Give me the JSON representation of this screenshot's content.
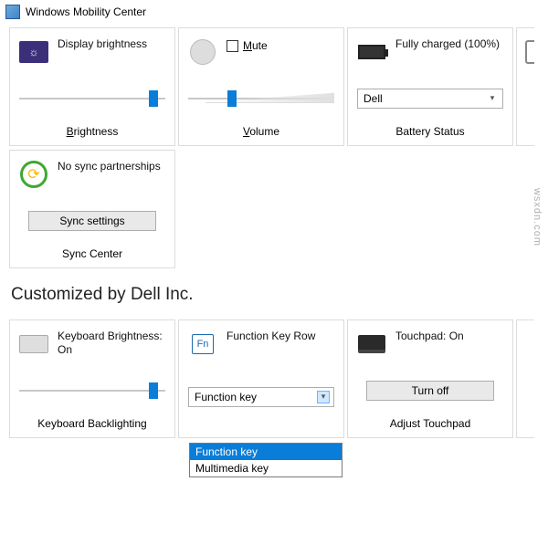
{
  "window": {
    "title": "Windows Mobility Center"
  },
  "tiles": {
    "brightness": {
      "desc": "Display brightness",
      "footer": "Brightness",
      "slider_pct": 92
    },
    "volume": {
      "mute_label": "Mute",
      "footer": "Volume",
      "slider_pct": 30
    },
    "battery": {
      "desc": "Fully charged (100%)",
      "select_value": "Dell",
      "footer": "Battery Status"
    },
    "sync": {
      "desc": "No sync partnerships",
      "button": "Sync settings",
      "footer": "Sync Center"
    }
  },
  "custom_header": "Customized by Dell Inc.",
  "custom_tiles": {
    "keyboard": {
      "desc": "Keyboard Brightness: On",
      "footer": "Keyboard Backlighting",
      "slider_pct": 92
    },
    "fnrow": {
      "desc": "Function Key Row",
      "select_value": "Function key",
      "options": [
        "Function key",
        "Multimedia key"
      ]
    },
    "touchpad": {
      "desc": "Touchpad: On",
      "button": "Turn off",
      "footer": "Adjust Touchpad"
    }
  },
  "watermark": "wsxdn.com"
}
